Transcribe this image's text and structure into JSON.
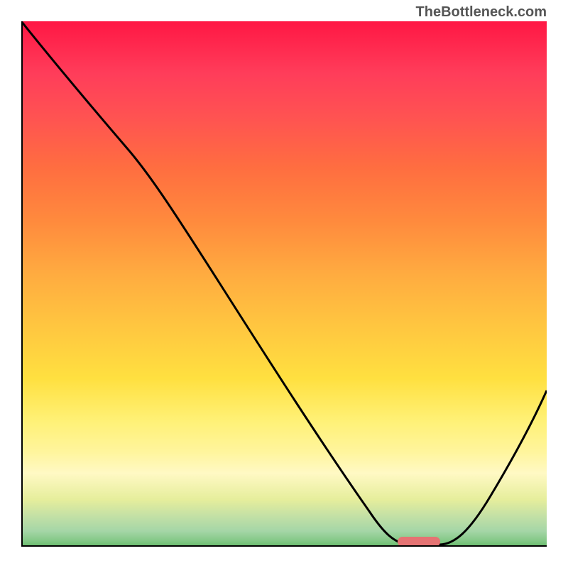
{
  "watermark": "TheBottleneck.com",
  "chart_data": {
    "type": "line",
    "title": "",
    "xlabel": "",
    "ylabel": "",
    "xlim": [
      0,
      100
    ],
    "ylim": [
      0,
      100
    ],
    "x": [
      0,
      5,
      10,
      15,
      20,
      25,
      30,
      35,
      40,
      45,
      50,
      55,
      60,
      65,
      70,
      75,
      80,
      85,
      90,
      95,
      100
    ],
    "values": [
      100,
      94,
      87,
      80,
      73,
      65,
      55,
      46,
      37,
      29,
      21,
      14,
      8,
      4,
      1,
      0,
      0,
      2,
      7,
      14,
      22
    ],
    "background_gradient": {
      "type": "vertical",
      "stops": [
        {
          "pos": 0,
          "color": "#ff1744"
        },
        {
          "pos": 50,
          "color": "#ffc640"
        },
        {
          "pos": 85,
          "color": "#fff9c4"
        },
        {
          "pos": 100,
          "color": "#66bb6a"
        }
      ]
    },
    "marker": {
      "x_center": 76,
      "y": 1.5,
      "color": "#e57373",
      "width_pct": 8
    }
  }
}
